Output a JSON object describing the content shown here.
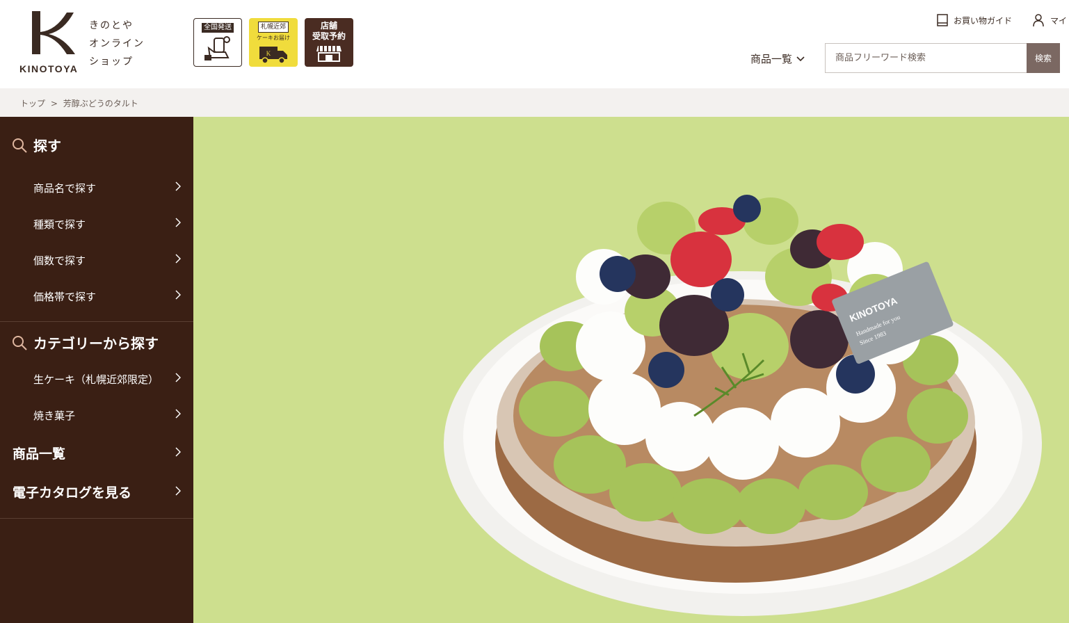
{
  "header": {
    "logo_en": "KINOTOYA",
    "logo_jp": [
      "きのとや",
      "オンライン",
      "ショップ"
    ],
    "badges": [
      {
        "tag": "全国発送"
      },
      {
        "tag": "札幌近郊",
        "sub": "ケーキお届け"
      },
      {
        "title_line1": "店舗",
        "title_line2": "受取予約"
      }
    ],
    "guide_label": "お買い物ガイド",
    "mypage_label": "マイ",
    "catalog_label": "商品一覧",
    "search_placeholder": "商品フリーワード検索",
    "search_button": "検索"
  },
  "breadcrumb": {
    "home": "トップ",
    "separator": ">",
    "current": "芳醇ぶどうのタルト"
  },
  "sidebar": {
    "search_heading": "探す",
    "search_items": [
      "商品名で探す",
      "種類で探す",
      "個数で探す",
      "価格帯で探す"
    ],
    "category_heading": "カテゴリーから探す",
    "category_items": [
      "生ケーキ（札幌近郊限定）",
      "焼き菓子"
    ],
    "all_products": "商品一覧",
    "catalog": "電子カタログを見る"
  },
  "hero": {
    "plaque_brand": "KINOTOYA",
    "plaque_line1": "Handmade for you",
    "plaque_line2": "Since 1983"
  },
  "colors": {
    "sidebar_bg": "#3a1f14",
    "hero_bg": "#cddf8e",
    "brand_brown": "#3a2a22",
    "search_button_bg": "#7b6862"
  }
}
